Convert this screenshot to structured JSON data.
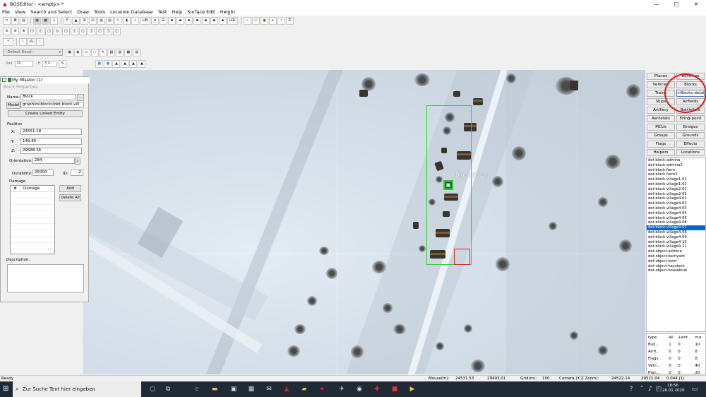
{
  "window": {
    "title": "BOSEditor - <empty> *",
    "minimize": "—",
    "maximize": "□",
    "close": "✕"
  },
  "menu": [
    "File",
    "View",
    "Search and Select",
    "Draw",
    "Tools",
    "Location Database",
    "Test",
    "Help",
    "Surface Edit",
    "Height"
  ],
  "toolbar": {
    "decal_select": "--Default Decal--",
    "rad_label": "Rad",
    "rad_value": "50",
    "h_label": "H",
    "h_value": "5.0",
    "tb1_labels": [
      "LIB",
      "LOC"
    ]
  },
  "mission": {
    "title": "My Mission (1)",
    "panel_title": "Block Properties",
    "name_label": "Name:",
    "name_value": "Block",
    "model_label": "Model",
    "model_value": "graphics\\blocks\\det-block-vill",
    "linked_button": "Create Linked Entity",
    "position_label": "Position",
    "x_label": "X:",
    "x_value": "24551.18",
    "y_label": "Y:",
    "y_value": "149.89",
    "z_label": "Z:",
    "z_value": "29588.36",
    "orientation_label": "Orientation:",
    "orientation_value": "284",
    "durability_label": "Durability:",
    "durability_value": "25000",
    "id_label": "ID:",
    "id_value": "2",
    "damage_label": "Damage",
    "damage_col_num": "#",
    "damage_col_damage": "Damage",
    "add_button": "Add",
    "delete_all_button": "Delete All",
    "description_label": "Description:"
  },
  "map": {
    "block_label": "Block (Id:2)"
  },
  "categories": [
    {
      "label": "Planes"
    },
    {
      "label": "Buildings"
    },
    {
      "label": "Vehicles"
    },
    {
      "label": "Blocks"
    },
    {
      "label": "Trains"
    },
    {
      "label": ">Blocks-detail<"
    },
    {
      "label": "Ships"
    },
    {
      "label": "Airfields"
    },
    {
      "label": "Artillery"
    },
    {
      "label": "Battlefield"
    },
    {
      "label": "Aerostats"
    },
    {
      "label": "Firing-point"
    },
    {
      "label": "MCUs"
    },
    {
      "label": "Bridges"
    },
    {
      "label": "Groups"
    },
    {
      "label": "Grounds"
    },
    {
      "label": "Flags"
    },
    {
      "label": "Effects"
    },
    {
      "label": "Helpers"
    },
    {
      "label": "Locations"
    }
  ],
  "objects": [
    "det-block-admina",
    "det-block-admina2",
    "det-block-farm",
    "det-block-farm2",
    "det-block-village1-01",
    "det-block-village1-02",
    "det-block-village2-01",
    "det-block-village2-02",
    "det-block-village4-01",
    "det-block-village4-02",
    "det-block-village4-03",
    "det-block-village4-04",
    "det-block-village4-05",
    "det-block-village4-06",
    "det-block-village4-07",
    "det-block-village4-08",
    "det-block-village4-09",
    "det-block-village4-10",
    "det-block-village4-11",
    "det-object-admina",
    "det-object-barnyard",
    "det-object-farm",
    "det-object-haystack",
    "det-object-houseblue"
  ],
  "selected_object_index": 14,
  "stats": {
    "headers": [
      "type",
      "all",
      "+ent",
      "ma"
    ],
    "rows": [
      [
        "Buil...",
        "1",
        "0",
        "10"
      ],
      [
        "Airfi...",
        "0",
        "0",
        "8"
      ],
      [
        "Flags",
        "0",
        "0",
        "8"
      ],
      [
        "Vehi...",
        "0",
        "0",
        "40"
      ],
      [
        "Plan...",
        "0",
        "0",
        "20"
      ]
    ]
  },
  "status": {
    "ready": "Ready",
    "mouse_label": "Mouse(m):",
    "mouse_x": "24531.53",
    "mouse_z": "29493.01",
    "grid_label": "Grid(m):",
    "grid_value": "100",
    "camera_label": "Camera (X Z Zoom):",
    "camera_x": "24522.14",
    "camera_z": "29521.04",
    "zoom": "0.044 (1)"
  },
  "taskbar": {
    "search_placeholder": "Zur Suche Text hier eingeben",
    "time": "18:56",
    "date": "26.01.2020"
  }
}
